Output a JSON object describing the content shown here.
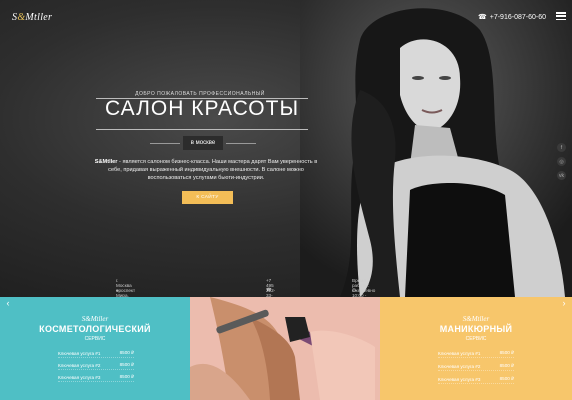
{
  "header": {
    "logo_text_1": "S",
    "logo_amp": "&",
    "logo_text_2": "Mtller",
    "phone_icon": "phone-icon",
    "phone": "+7-916-087-60-60",
    "menu_icon": "hamburger-icon"
  },
  "hero": {
    "welcome": "ДОБРО ПОЖАЛОВАТЬ ПРОФЕССИОНАЛЬНЫЙ",
    "title": "САЛОН КРАСОТЫ",
    "city": "в москве",
    "desc_brand": "S&Mtller",
    "desc_text": " - является салоном бизнес-класса. Наши мастера дарят Вам уверенность в себе, придавая выраженный индивидуальную внешности. В салоне можно воспользоваться услугами бьюти-индустрии.",
    "cta_label": "К САЙТУ",
    "social": [
      {
        "icon": "facebook-icon",
        "glyph": "f"
      },
      {
        "icon": "instagram-icon",
        "glyph": "◎"
      },
      {
        "icon": "vk-icon",
        "glyph": "vk"
      }
    ]
  },
  "info": {
    "address": "г. Москва проспект Мира, 146",
    "phone": "+7 495 222-33-44",
    "hours": "Время работы: ежедневно 10:00 - 22:00"
  },
  "panels": {
    "left": {
      "logo": "S&Mtller",
      "title": "КОСМЕТОЛОГИЧЕСКИЙ",
      "subtitle": "СЕРВИС",
      "services": [
        {
          "name": "Ключевая услуга #1",
          "price": "8500 ₽"
        },
        {
          "name": "Ключевая услуга #2",
          "price": "8500 ₽"
        },
        {
          "name": "Ключевая услуга #3",
          "price": "8500 ₽"
        }
      ]
    },
    "right": {
      "logo": "S&Mtller",
      "title": "МАНИКЮРНЫЙ",
      "subtitle": "СЕРВИС",
      "services": [
        {
          "name": "Ключевая услуга #1",
          "price": "8500 ₽"
        },
        {
          "name": "Ключевая услуга #2",
          "price": "8500 ₽"
        },
        {
          "name": "Ключевая услуга #3",
          "price": "8500 ₽"
        }
      ]
    }
  },
  "arrows": {
    "left": "‹",
    "right": "›"
  },
  "colors": {
    "accent": "#f3bd57",
    "teal": "#4fbfc5",
    "peach": "#f7c66b",
    "pink": "#e9b2a6"
  }
}
